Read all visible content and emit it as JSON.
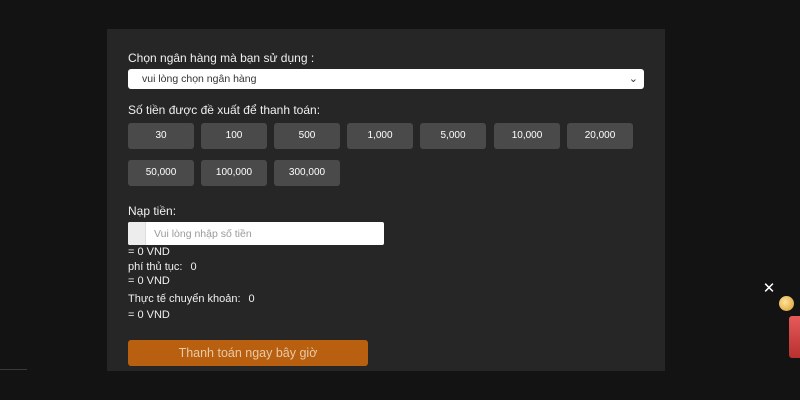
{
  "form": {
    "bank_label": "Chọn ngân hàng mà bạn sử dụng :",
    "bank_select_value": "vui lòng chọn ngân hàng",
    "suggested_label": "Số tiền được đề xuất để thanh toán:",
    "amounts": [
      "30",
      "100",
      "500",
      "1,000",
      "5,000",
      "10,000",
      "20,000",
      "50,000",
      "100,000",
      "300,000"
    ],
    "deposit_label": "Nạp tiền:",
    "deposit_placeholder": "Vui lòng nhập số tiền",
    "deposit_converted": "= 0 VND",
    "fee_label": "phí thủ tục:",
    "fee_value": "0",
    "fee_converted": "= 0 VND",
    "actual_label": "Thực tế chuyển khoản:",
    "actual_value": "0",
    "actual_converted": "= 0 VND",
    "pay_button": "Thanh toán ngay bây giờ"
  },
  "overlay": {
    "close_symbol": "✕"
  },
  "colors": {
    "panel_bg": "#262626",
    "amount_button_bg": "#4a4a4a",
    "pay_button_bg": "#b8600f"
  }
}
